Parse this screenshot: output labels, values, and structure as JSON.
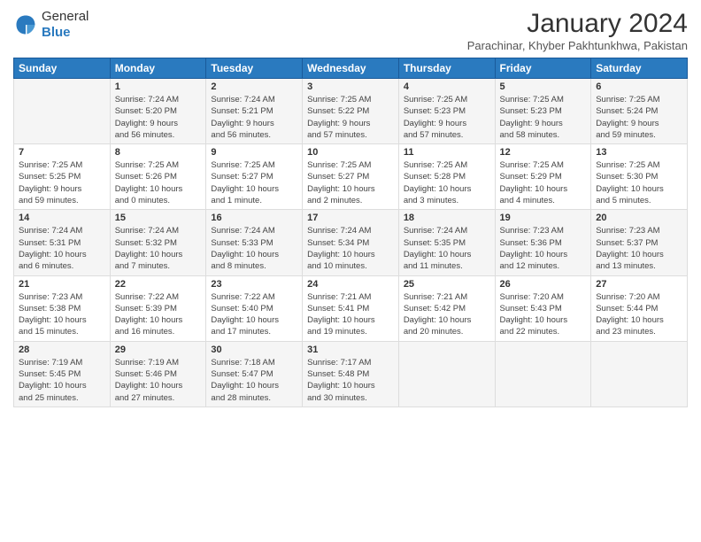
{
  "header": {
    "logo_general": "General",
    "logo_blue": "Blue",
    "title": "January 2024",
    "subtitle": "Parachinar, Khyber Pakhtunkhwa, Pakistan"
  },
  "columns": [
    "Sunday",
    "Monday",
    "Tuesday",
    "Wednesday",
    "Thursday",
    "Friday",
    "Saturday"
  ],
  "weeks": [
    [
      {
        "day": "",
        "info": ""
      },
      {
        "day": "1",
        "info": "Sunrise: 7:24 AM\nSunset: 5:20 PM\nDaylight: 9 hours\nand 56 minutes."
      },
      {
        "day": "2",
        "info": "Sunrise: 7:24 AM\nSunset: 5:21 PM\nDaylight: 9 hours\nand 56 minutes."
      },
      {
        "day": "3",
        "info": "Sunrise: 7:25 AM\nSunset: 5:22 PM\nDaylight: 9 hours\nand 57 minutes."
      },
      {
        "day": "4",
        "info": "Sunrise: 7:25 AM\nSunset: 5:23 PM\nDaylight: 9 hours\nand 57 minutes."
      },
      {
        "day": "5",
        "info": "Sunrise: 7:25 AM\nSunset: 5:23 PM\nDaylight: 9 hours\nand 58 minutes."
      },
      {
        "day": "6",
        "info": "Sunrise: 7:25 AM\nSunset: 5:24 PM\nDaylight: 9 hours\nand 59 minutes."
      }
    ],
    [
      {
        "day": "7",
        "info": "Sunrise: 7:25 AM\nSunset: 5:25 PM\nDaylight: 9 hours\nand 59 minutes."
      },
      {
        "day": "8",
        "info": "Sunrise: 7:25 AM\nSunset: 5:26 PM\nDaylight: 10 hours\nand 0 minutes."
      },
      {
        "day": "9",
        "info": "Sunrise: 7:25 AM\nSunset: 5:27 PM\nDaylight: 10 hours\nand 1 minute."
      },
      {
        "day": "10",
        "info": "Sunrise: 7:25 AM\nSunset: 5:27 PM\nDaylight: 10 hours\nand 2 minutes."
      },
      {
        "day": "11",
        "info": "Sunrise: 7:25 AM\nSunset: 5:28 PM\nDaylight: 10 hours\nand 3 minutes."
      },
      {
        "day": "12",
        "info": "Sunrise: 7:25 AM\nSunset: 5:29 PM\nDaylight: 10 hours\nand 4 minutes."
      },
      {
        "day": "13",
        "info": "Sunrise: 7:25 AM\nSunset: 5:30 PM\nDaylight: 10 hours\nand 5 minutes."
      }
    ],
    [
      {
        "day": "14",
        "info": "Sunrise: 7:24 AM\nSunset: 5:31 PM\nDaylight: 10 hours\nand 6 minutes."
      },
      {
        "day": "15",
        "info": "Sunrise: 7:24 AM\nSunset: 5:32 PM\nDaylight: 10 hours\nand 7 minutes."
      },
      {
        "day": "16",
        "info": "Sunrise: 7:24 AM\nSunset: 5:33 PM\nDaylight: 10 hours\nand 8 minutes."
      },
      {
        "day": "17",
        "info": "Sunrise: 7:24 AM\nSunset: 5:34 PM\nDaylight: 10 hours\nand 10 minutes."
      },
      {
        "day": "18",
        "info": "Sunrise: 7:24 AM\nSunset: 5:35 PM\nDaylight: 10 hours\nand 11 minutes."
      },
      {
        "day": "19",
        "info": "Sunrise: 7:23 AM\nSunset: 5:36 PM\nDaylight: 10 hours\nand 12 minutes."
      },
      {
        "day": "20",
        "info": "Sunrise: 7:23 AM\nSunset: 5:37 PM\nDaylight: 10 hours\nand 13 minutes."
      }
    ],
    [
      {
        "day": "21",
        "info": "Sunrise: 7:23 AM\nSunset: 5:38 PM\nDaylight: 10 hours\nand 15 minutes."
      },
      {
        "day": "22",
        "info": "Sunrise: 7:22 AM\nSunset: 5:39 PM\nDaylight: 10 hours\nand 16 minutes."
      },
      {
        "day": "23",
        "info": "Sunrise: 7:22 AM\nSunset: 5:40 PM\nDaylight: 10 hours\nand 17 minutes."
      },
      {
        "day": "24",
        "info": "Sunrise: 7:21 AM\nSunset: 5:41 PM\nDaylight: 10 hours\nand 19 minutes."
      },
      {
        "day": "25",
        "info": "Sunrise: 7:21 AM\nSunset: 5:42 PM\nDaylight: 10 hours\nand 20 minutes."
      },
      {
        "day": "26",
        "info": "Sunrise: 7:20 AM\nSunset: 5:43 PM\nDaylight: 10 hours\nand 22 minutes."
      },
      {
        "day": "27",
        "info": "Sunrise: 7:20 AM\nSunset: 5:44 PM\nDaylight: 10 hours\nand 23 minutes."
      }
    ],
    [
      {
        "day": "28",
        "info": "Sunrise: 7:19 AM\nSunset: 5:45 PM\nDaylight: 10 hours\nand 25 minutes."
      },
      {
        "day": "29",
        "info": "Sunrise: 7:19 AM\nSunset: 5:46 PM\nDaylight: 10 hours\nand 27 minutes."
      },
      {
        "day": "30",
        "info": "Sunrise: 7:18 AM\nSunset: 5:47 PM\nDaylight: 10 hours\nand 28 minutes."
      },
      {
        "day": "31",
        "info": "Sunrise: 7:17 AM\nSunset: 5:48 PM\nDaylight: 10 hours\nand 30 minutes."
      },
      {
        "day": "",
        "info": ""
      },
      {
        "day": "",
        "info": ""
      },
      {
        "day": "",
        "info": ""
      }
    ]
  ]
}
